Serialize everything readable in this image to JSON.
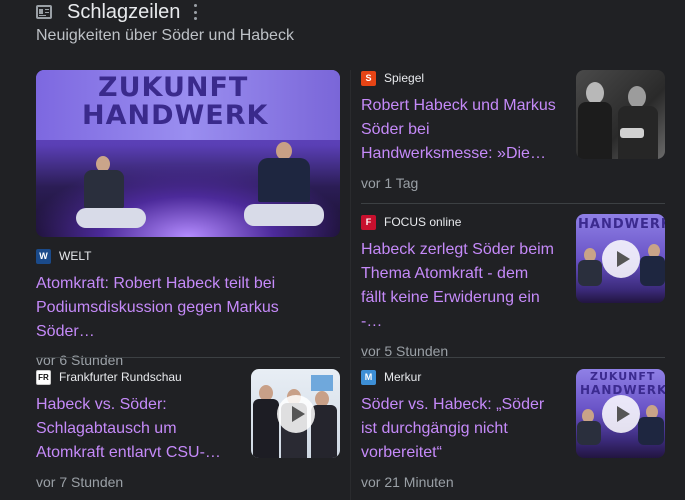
{
  "header": {
    "title": "Schlagzeilen",
    "subtitle": "Neuigkeiten über Söder und Habeck"
  },
  "colors": {
    "background": "#202124",
    "link": "#c58af9",
    "meta": "#9aa0a6",
    "divider": "#3c4043"
  },
  "articles": [
    {
      "source": "WELT",
      "favicon_text": "W",
      "favicon_color": "#1a4a8a",
      "headline": "Atomkraft: Robert Habeck teilt bei Podiumsdiskussion gegen Markus Söder…",
      "time": "vor 6 Stunden",
      "image_text_1": "ZUKUNFT",
      "image_text_2": "HANDWERK"
    },
    {
      "source": "Spiegel",
      "favicon_text": "S",
      "favicon_color": "#e64415",
      "headline": "Robert Habeck und Markus Söder bei Handwerksmesse: »Die…",
      "time": "vor 1 Tag"
    },
    {
      "source": "FOCUS online",
      "favicon_text": "F",
      "favicon_color": "#c8102e",
      "headline": "Habeck zerlegt Söder beim Thema Atomkraft - dem fällt keine Erwiderung ein -…",
      "time": "vor 5 Stunden",
      "image_text": "HANDWERK"
    },
    {
      "source": "Frankfurter Rundschau",
      "favicon_text": "FR",
      "favicon_color": "#ffffff",
      "headline": "Habeck vs. Söder: Schlagabtausch um Atomkraft entlarvt CSU-…",
      "time": "vor 7 Stunden"
    },
    {
      "source": "Merkur",
      "favicon_text": "M",
      "favicon_color": "#3d8fd6",
      "headline": "Söder vs. Habeck: „Söder ist durchgängig nicht vorbereitet“",
      "time": "vor 21 Minuten",
      "image_text_1": "ZUKUNFT",
      "image_text_2": "HANDWERK"
    }
  ]
}
